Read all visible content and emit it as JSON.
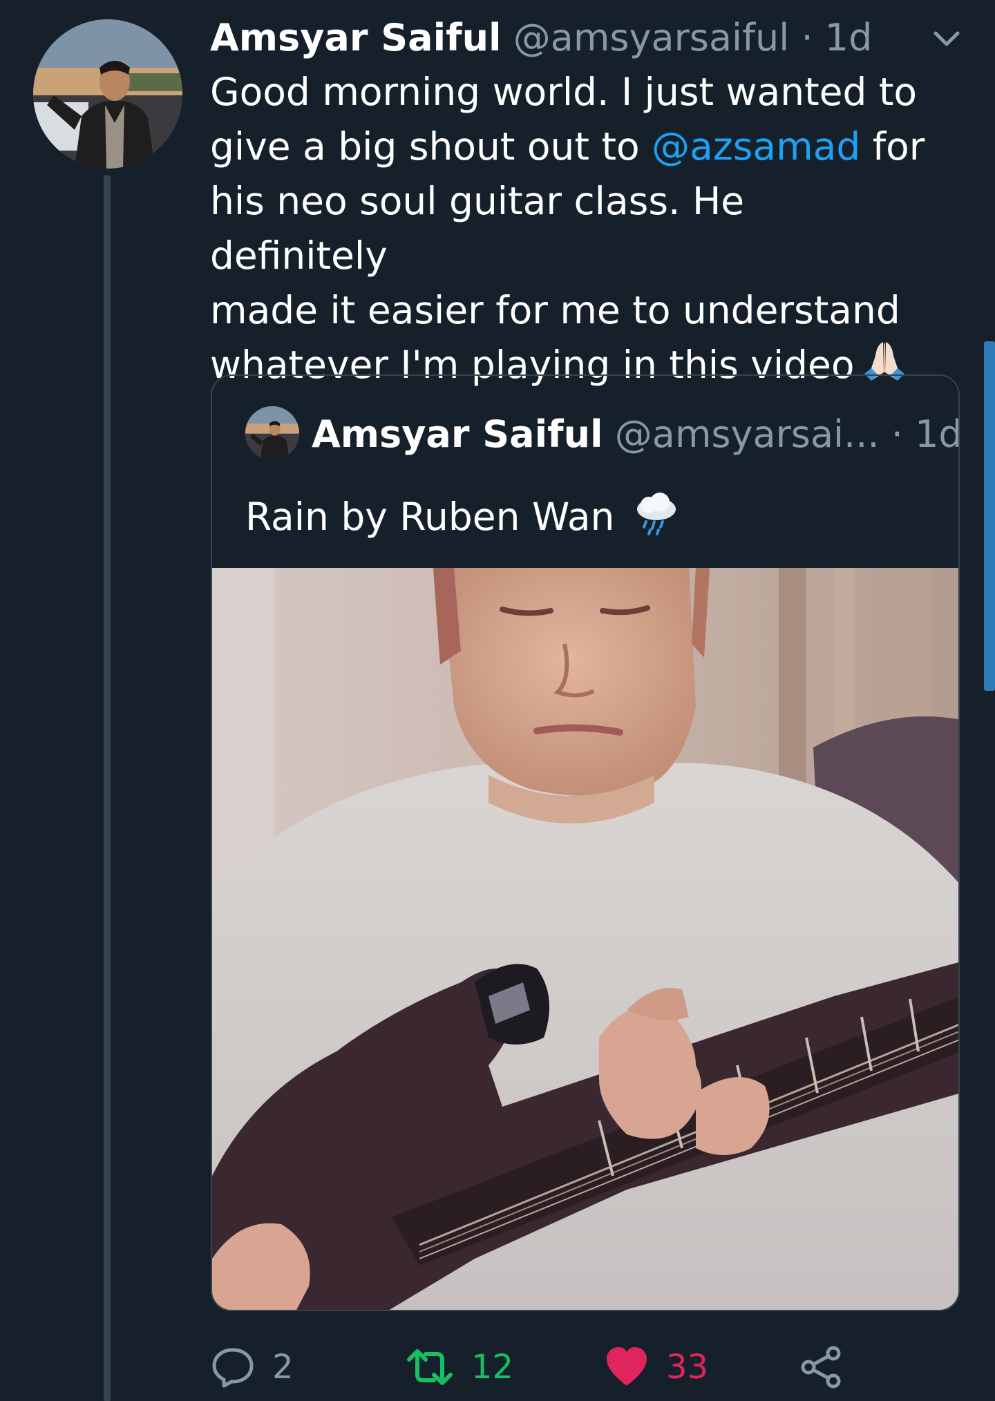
{
  "tweet": {
    "author": {
      "name": "Amsyar Saiful",
      "handle": "@amsyarsaiful",
      "separator": "·",
      "time": "1d"
    },
    "text": {
      "line1": "Good morning world. I just wanted to",
      "line2_before": "give a big shout out to ",
      "mention": "@azsamad",
      "line2_after": " for",
      "line3": "his neo soul guitar class. He definitely",
      "line4": "made it easier for me to understand",
      "line5": "whatever I'm playing in this video"
    },
    "emoji": "folded-hands-emoji",
    "menu_icon": "chevron-down-icon"
  },
  "quoted_tweet": {
    "author": {
      "name": "Amsyar Saiful",
      "handle": "@amsyarsai...",
      "separator": "·",
      "time": "1d"
    },
    "text": "Rain by Ruben Wan",
    "emoji": "cloud-with-rain-emoji",
    "media": "video-thumbnail-guitarist"
  },
  "actions": {
    "reply": {
      "icon": "reply-icon",
      "count": "2"
    },
    "retweet": {
      "icon": "retweet-icon",
      "count": "12"
    },
    "like": {
      "icon": "heart-icon",
      "count": "33"
    },
    "share": {
      "icon": "share-icon"
    }
  },
  "colors": {
    "background": "#15202b",
    "text": "#ffffff",
    "secondary": "#8899a6",
    "link": "#1da1f2",
    "retweet_active": "#17bf63",
    "like_active": "#e0245e",
    "border": "#38444d"
  }
}
